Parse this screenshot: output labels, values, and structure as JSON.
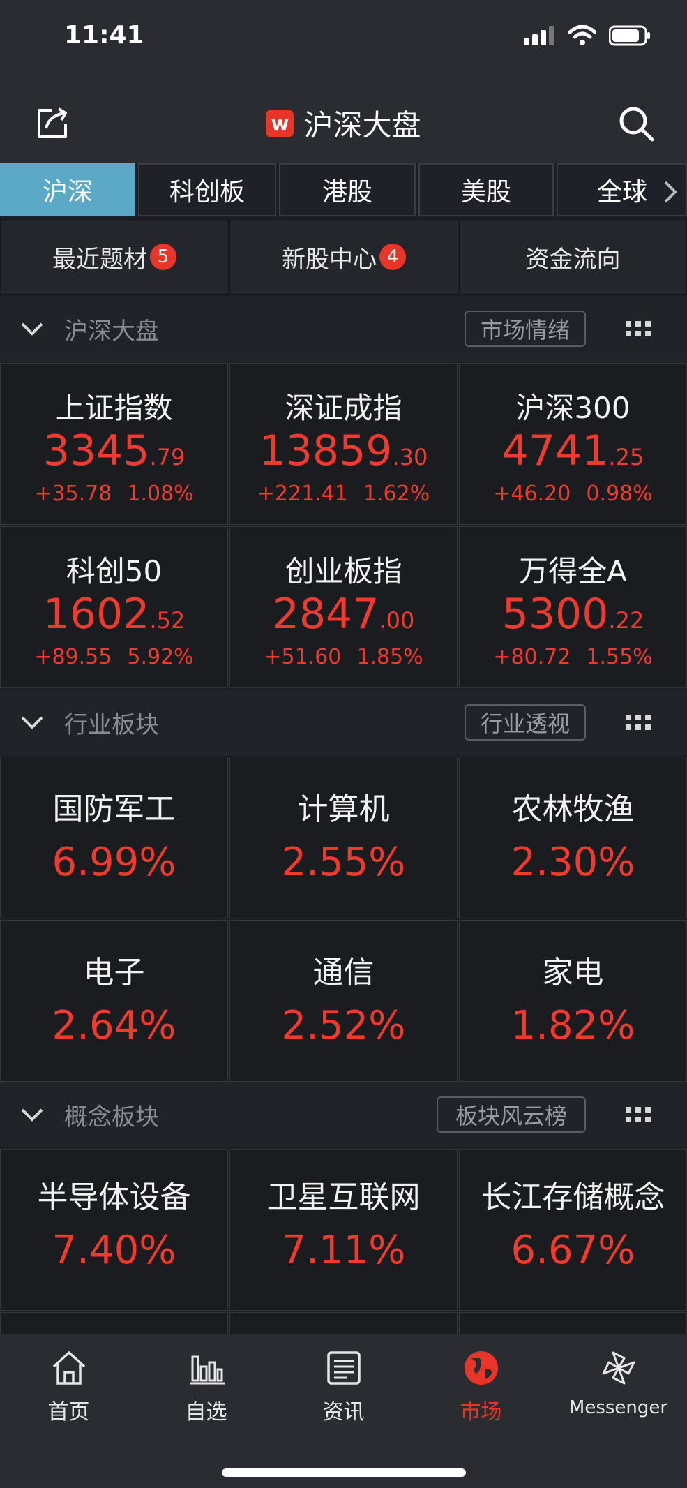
{
  "status_bar": {
    "time": "11:41"
  },
  "nav": {
    "logo_letter": "w",
    "title": "沪深大盘"
  },
  "tabs": [
    {
      "label": "沪深",
      "active": true
    },
    {
      "label": "科创板",
      "active": false
    },
    {
      "label": "港股",
      "active": false
    },
    {
      "label": "美股",
      "active": false
    },
    {
      "label": "全球",
      "active": false
    }
  ],
  "quick_links": [
    {
      "label": "最近题材",
      "badge": "5"
    },
    {
      "label": "新股中心",
      "badge": "4"
    },
    {
      "label": "资金流向",
      "badge": ""
    }
  ],
  "sections": {
    "market": {
      "title": "沪深大盘",
      "button": "市场情绪"
    },
    "industry": {
      "title": "行业板块",
      "button": "行业透视"
    },
    "concept": {
      "title": "概念板块",
      "button": "板块风云榜"
    }
  },
  "indices": [
    {
      "name": "上证指数",
      "int": "3345",
      "dec": ".79",
      "change": "+35.78",
      "pct": "1.08%"
    },
    {
      "name": "深证成指",
      "int": "13859",
      "dec": ".30",
      "change": "+221.41",
      "pct": "1.62%"
    },
    {
      "name": "沪深300",
      "int": "4741",
      "dec": ".25",
      "change": "+46.20",
      "pct": "0.98%"
    },
    {
      "name": "科创50",
      "int": "1602",
      "dec": ".52",
      "change": "+89.55",
      "pct": "5.92%"
    },
    {
      "name": "创业板指",
      "int": "2847",
      "dec": ".00",
      "change": "+51.60",
      "pct": "1.85%"
    },
    {
      "name": "万得全A",
      "int": "5300",
      "dec": ".22",
      "change": "+80.72",
      "pct": "1.55%"
    }
  ],
  "industries": [
    {
      "name": "国防军工",
      "pct": "6.99%"
    },
    {
      "name": "计算机",
      "pct": "2.55%"
    },
    {
      "name": "农林牧渔",
      "pct": "2.30%"
    },
    {
      "name": "电子",
      "pct": "2.64%"
    },
    {
      "name": "通信",
      "pct": "2.52%"
    },
    {
      "name": "家电",
      "pct": "1.82%"
    }
  ],
  "concepts": [
    {
      "name": "半导体设备",
      "pct": "7.40%"
    },
    {
      "name": "卫星互联网",
      "pct": "7.11%"
    },
    {
      "name": "长江存储概念",
      "pct": "6.67%"
    }
  ],
  "bottom_tabs": [
    {
      "label": "首页",
      "icon": "home-icon"
    },
    {
      "label": "自选",
      "icon": "chart-bars-icon"
    },
    {
      "label": "资讯",
      "icon": "news-icon"
    },
    {
      "label": "市场",
      "icon": "globe-icon",
      "active": true
    },
    {
      "label": "Messenger",
      "icon": "pinwheel-icon"
    }
  ],
  "colors": {
    "up": "#f03a2e",
    "accent": "#5ba9c6",
    "brand": "#e8352a"
  }
}
